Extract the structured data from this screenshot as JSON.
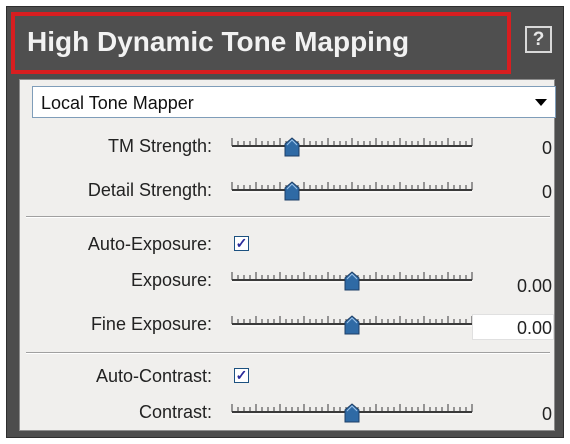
{
  "window": {
    "title": "High Dynamic Tone Mapping",
    "help_label": "?"
  },
  "mapper": {
    "selected": "Local Tone Mapper"
  },
  "controls": {
    "tm_strength": {
      "label": "TM Strength:",
      "value": "0",
      "position": 0.25
    },
    "detail_strength": {
      "label": "Detail Strength:",
      "value": "0",
      "position": 0.25
    },
    "auto_exposure": {
      "label": "Auto-Exposure:",
      "checked": true,
      "mark": "✓"
    },
    "exposure": {
      "label": "Exposure:",
      "value": "0.00",
      "position": 0.5
    },
    "fine_exposure": {
      "label": "Fine Exposure:",
      "value": "0.00",
      "position": 0.5
    },
    "auto_contrast": {
      "label": "Auto-Contrast:",
      "checked": true,
      "mark": "✓"
    },
    "contrast": {
      "label": "Contrast:",
      "value": "0",
      "position": 0.5
    }
  },
  "colors": {
    "highlight": "#d81e20",
    "thumb": "#2f6aa5",
    "panel": "#4d4d4d"
  }
}
